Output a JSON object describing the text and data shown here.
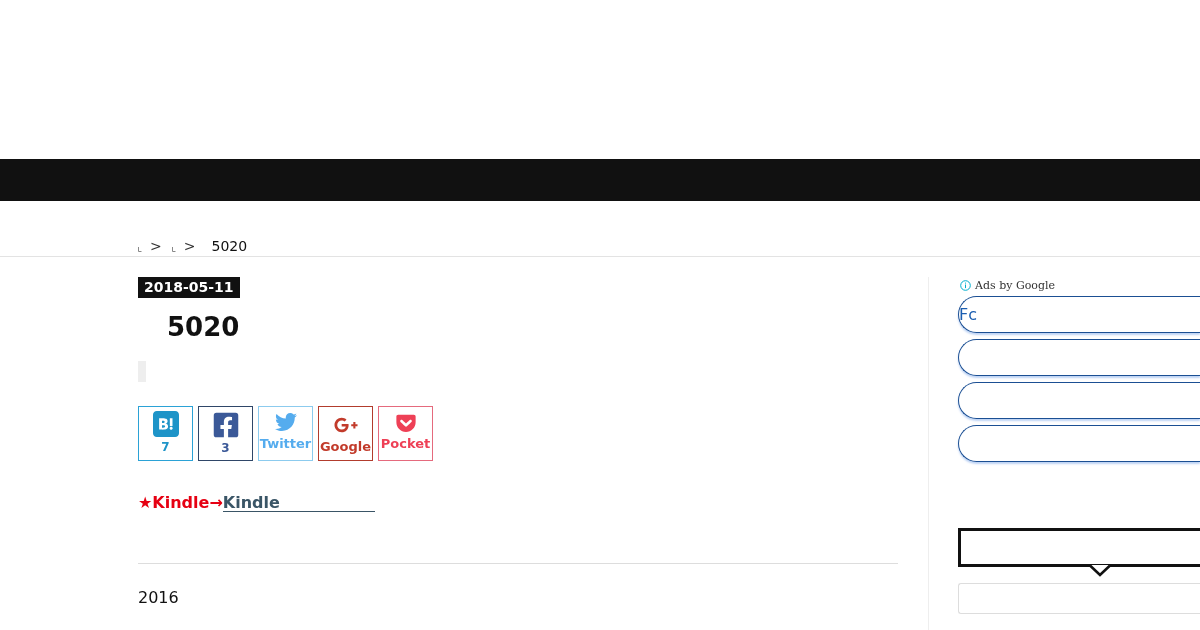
{
  "breadcrumb": [
    {
      "kind": "link",
      "separator": ">"
    },
    {
      "kind": "link",
      "separator": ">"
    },
    {
      "kind": "current",
      "label": "5020"
    }
  ],
  "article": {
    "date": "2018-05-11",
    "title": "5020",
    "share_buttons": [
      {
        "kind": "hatena",
        "count": "7"
      },
      {
        "kind": "facebook",
        "count": "3"
      },
      {
        "kind": "twitter",
        "label": "Twitter"
      },
      {
        "kind": "google",
        "label": "Google"
      },
      {
        "kind": "pocket",
        "label": "Pocket"
      }
    ],
    "promo": {
      "lead": "★Kindle→",
      "link": "Kindle"
    },
    "body_text": "2016"
  },
  "sidebar": {
    "ad_label": "Ads by Google",
    "ad_links": [
      {
        "kind": "text",
        "label": "Fc"
      },
      {
        "kind": "blank"
      },
      {
        "kind": "blank"
      },
      {
        "kind": "blank"
      }
    ]
  }
}
